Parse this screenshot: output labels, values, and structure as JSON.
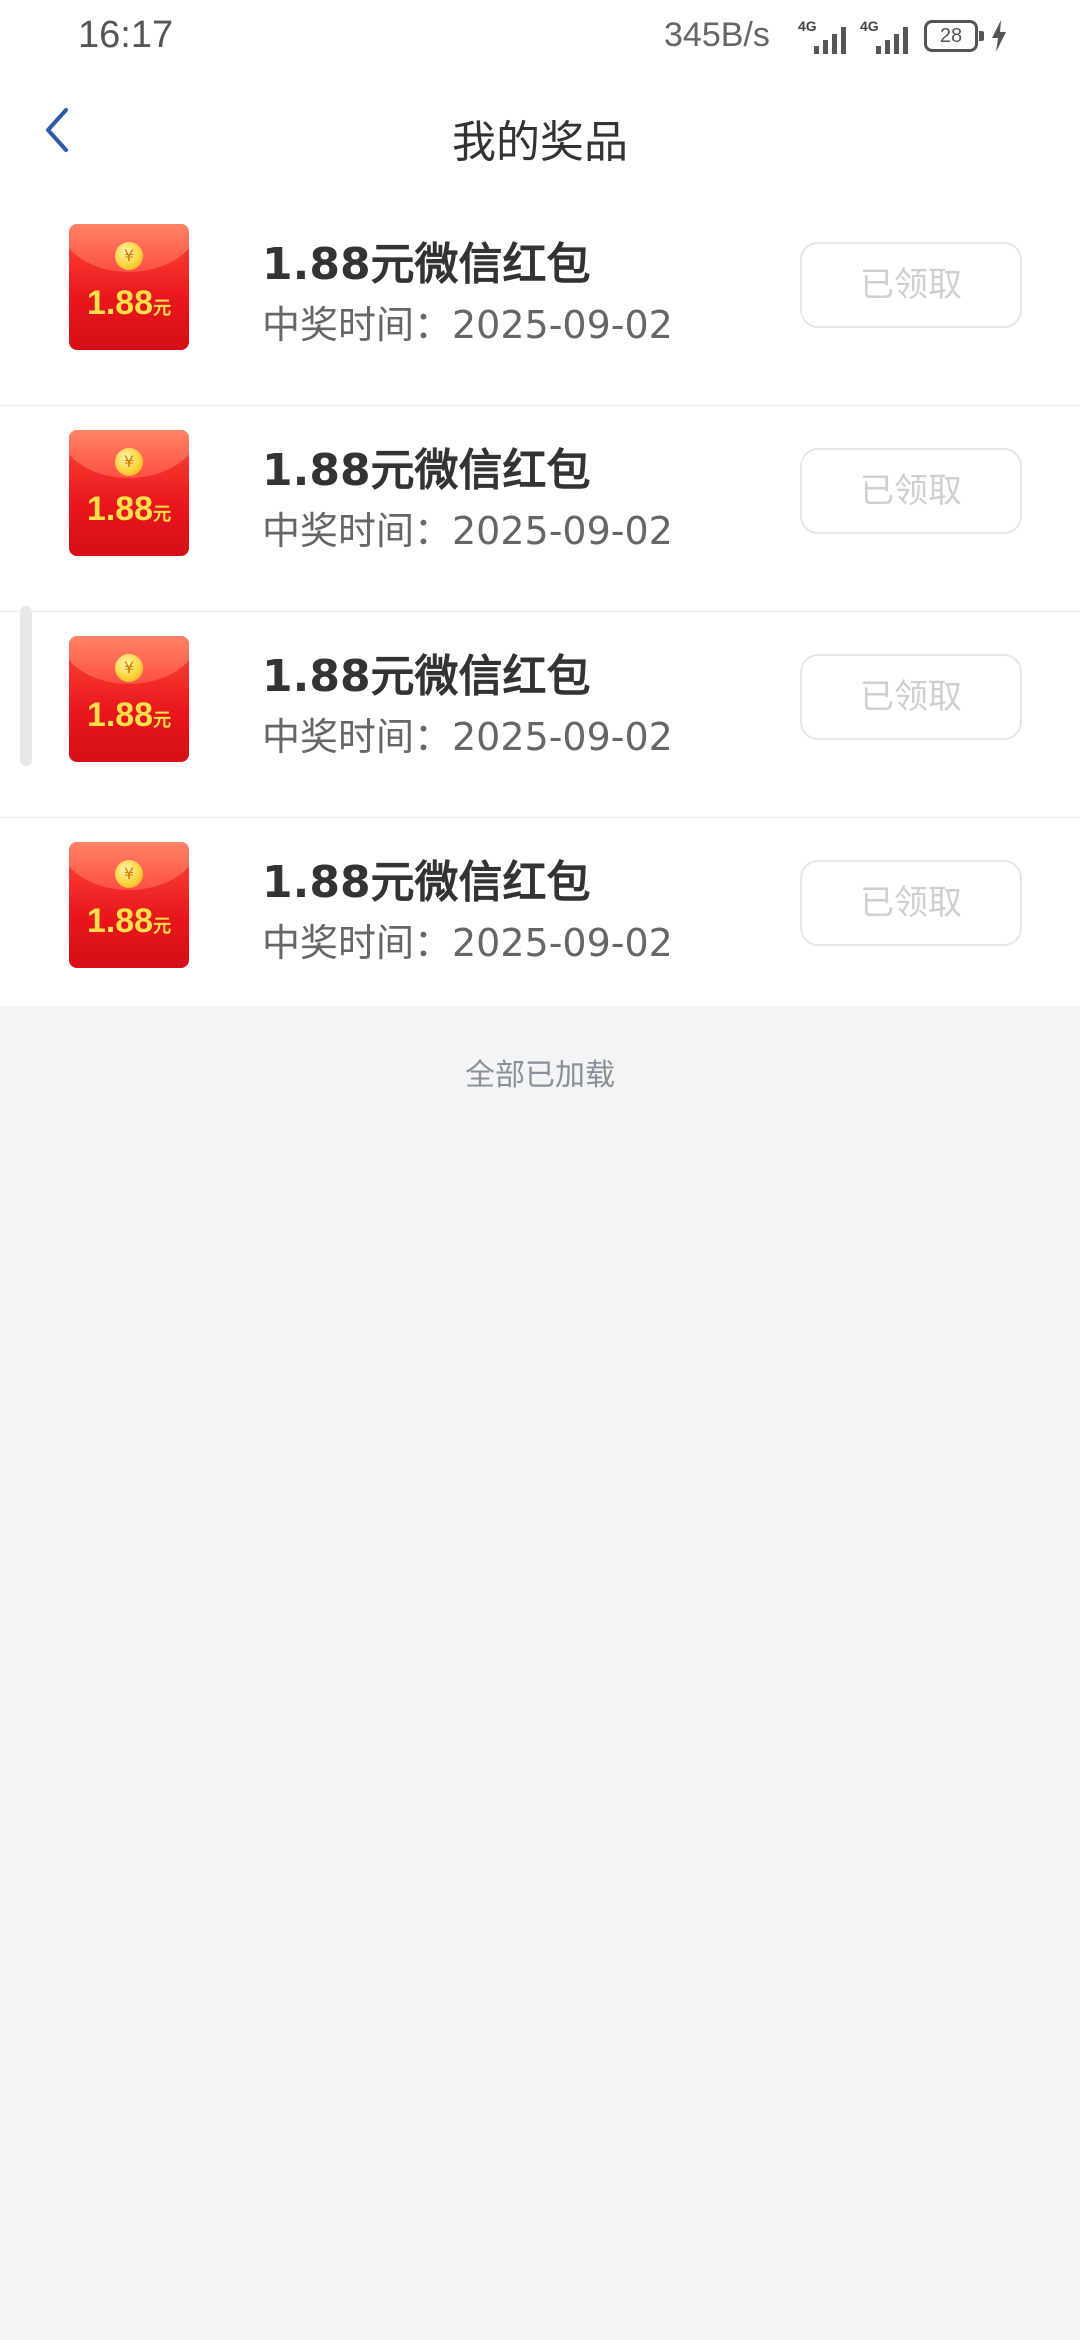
{
  "status_bar": {
    "time": "16:17",
    "network_speed": "345B/s",
    "signal_1_label": "4G",
    "signal_2_label": "4G",
    "battery_level": "28"
  },
  "header": {
    "title": "我的奖品"
  },
  "prizes": [
    {
      "envelope_amount": "1.88",
      "envelope_unit": "元",
      "title": "1.88元微信红包",
      "date": "中奖时间：2025-09-02",
      "button_label": "已领取"
    },
    {
      "envelope_amount": "1.88",
      "envelope_unit": "元",
      "title": "1.88元微信红包",
      "date": "中奖时间：2025-09-02",
      "button_label": "已领取"
    },
    {
      "envelope_amount": "1.88",
      "envelope_unit": "元",
      "title": "1.88元微信红包",
      "date": "中奖时间：2025-09-02",
      "button_label": "已领取"
    },
    {
      "envelope_amount": "1.88",
      "envelope_unit": "元",
      "title": "1.88元微信红包",
      "date": "中奖时间：2025-09-02",
      "button_label": "已领取"
    }
  ],
  "footer": {
    "loaded_text": "全部已加载"
  },
  "colors": {
    "accent": "#2b5aa8",
    "envelope_red": "#e8161b",
    "coin_gold": "#ffd23a",
    "page_bg": "#f3f4f6"
  },
  "icons": {
    "back": "chevron-left-icon",
    "coin": "yuan-coin-icon",
    "bolt": "charging-bolt-icon"
  }
}
